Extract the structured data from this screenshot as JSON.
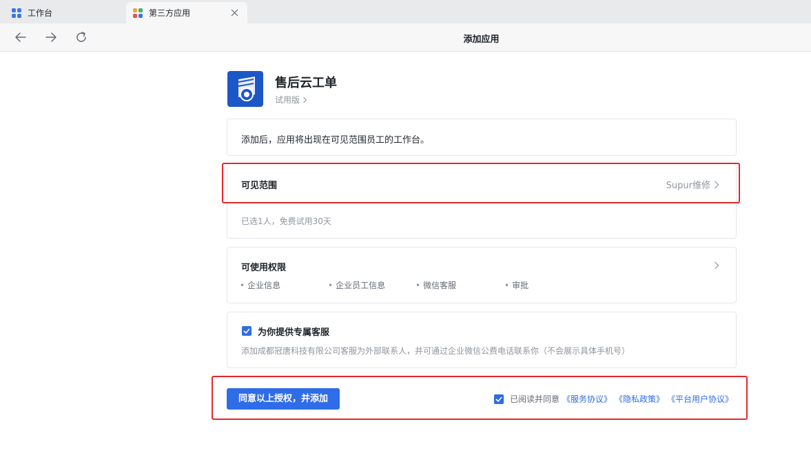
{
  "tabs": [
    {
      "label": "工作台"
    },
    {
      "label": "第三方应用"
    }
  ],
  "nav": {
    "title": "添加应用"
  },
  "app": {
    "name": "售后云工单",
    "edition": "试用版"
  },
  "notice": "添加后，应用将出现在可见范围员工的工作台。",
  "scope": {
    "title": "可见范围",
    "value": "Supur维修",
    "sub": "已选1人，免费试用30天"
  },
  "permissions": {
    "title": "可使用权限",
    "items": [
      "企业信息",
      "企业员工信息",
      "微信客服",
      "审批"
    ]
  },
  "service": {
    "title": "为你提供专属客服",
    "checked": true,
    "desc": "添加成都冠唐科技有限公司客服为外部联系人，并可通过企业微信公费电话联系你（不会展示具体手机号）"
  },
  "footer": {
    "button": "同意以上授权，并添加",
    "agree_text": "已阅读并同意",
    "links": [
      "《服务协议》",
      "《隐私政策》",
      "《平台用户协议》"
    ]
  },
  "colors": {
    "accent": "#2f6ce8",
    "highlight": "#e5262a",
    "logo": "#1c57c7"
  }
}
